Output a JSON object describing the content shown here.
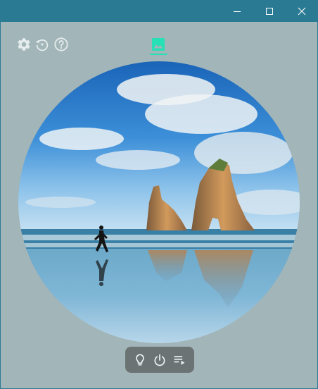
{
  "window": {
    "title": "",
    "colors": {
      "titlebar": "#2b7a94",
      "client": "#a2b5b8",
      "accent": "#27e0b6"
    }
  },
  "caption_buttons": [
    "minimize-icon",
    "maximize-icon",
    "close-icon"
  ],
  "toolbar": {
    "left_icons": [
      "gear-icon",
      "history-icon",
      "help-icon"
    ],
    "active_tab_icon": "image-icon"
  },
  "wallpaper": {
    "subject": "beach-with-rock-arches-and-runner"
  },
  "control_bar": {
    "icons": [
      "lightbulb-icon",
      "power-icon",
      "playlist-icon"
    ],
    "background": "#6b7374"
  }
}
